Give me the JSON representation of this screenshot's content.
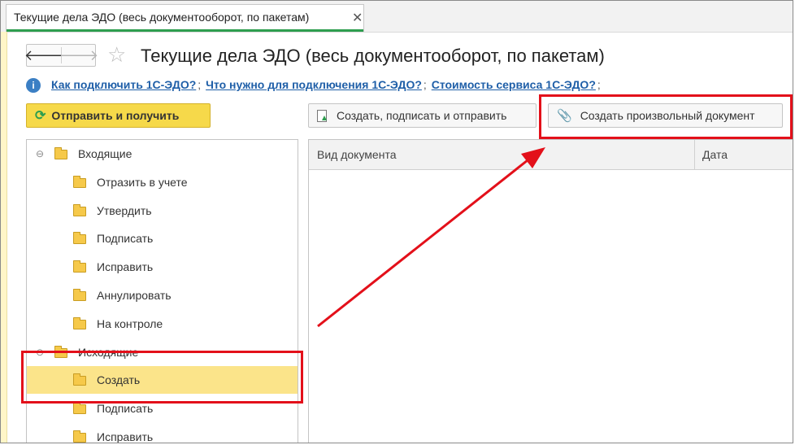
{
  "tab": {
    "label": "Текущие дела ЭДО (весь документооборот, по пакетам)",
    "close_glyph": "✕"
  },
  "nav": {
    "back_glyph": "🡐",
    "forward_glyph": "🡒"
  },
  "header": {
    "star_glyph": "☆",
    "title": "Текущие дела ЭДО (весь документооборот, по пакетам)"
  },
  "info": {
    "icon_glyph": "i",
    "links": [
      {
        "label": "Как подключить 1С-ЭДО?"
      },
      {
        "label": "Что нужно для подключения 1С-ЭДО?"
      },
      {
        "label": "Стоимость сервиса 1С-ЭДО?"
      }
    ],
    "separator": ";"
  },
  "toolbar": {
    "send_receive_label": "Отправить и получить",
    "create_sign_send_label": "Создать, подписать и отправить",
    "create_any_document_label": "Создать произвольный документ"
  },
  "tree": {
    "collapse_glyph": "⊖",
    "items": [
      {
        "label": "Входящие",
        "level": 0,
        "selected": false
      },
      {
        "label": "Отразить в учете",
        "level": 1,
        "selected": false
      },
      {
        "label": "Утвердить",
        "level": 1,
        "selected": false
      },
      {
        "label": "Подписать",
        "level": 1,
        "selected": false
      },
      {
        "label": "Исправить",
        "level": 1,
        "selected": false
      },
      {
        "label": "Аннулировать",
        "level": 1,
        "selected": false
      },
      {
        "label": "На контроле",
        "level": 1,
        "selected": false
      },
      {
        "label": "Исходящие",
        "level": 0,
        "selected": false
      },
      {
        "label": "Создать",
        "level": 1,
        "selected": true
      },
      {
        "label": "Подписать",
        "level": 1,
        "selected": false
      },
      {
        "label": "Исправить",
        "level": 1,
        "selected": false
      }
    ]
  },
  "grid": {
    "columns": [
      {
        "label": "Вид документа"
      },
      {
        "label": "Дата"
      }
    ]
  },
  "colors": {
    "accent_green": "#2e9e4f",
    "highlight_red": "#e3101a",
    "send_button_yellow": "#f6d94a",
    "selection_yellow": "#fbe48a",
    "link_blue": "#1f5fa8"
  }
}
